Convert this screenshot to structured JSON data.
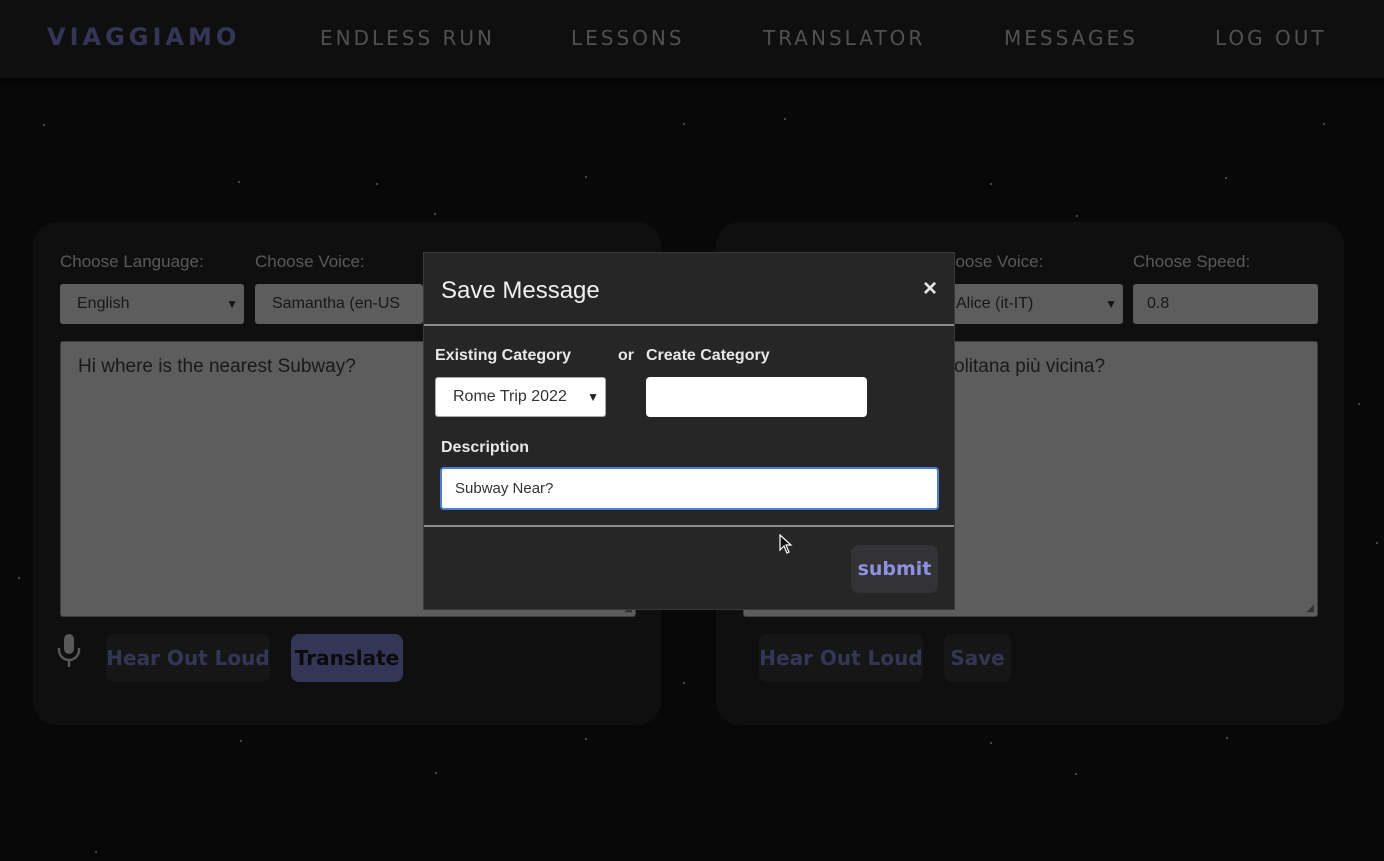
{
  "nav": {
    "brand": "VIAGGIAMO",
    "links": [
      "ENDLESS RUN",
      "LESSONS",
      "TRANSLATOR",
      "MESSAGES",
      "LOG OUT"
    ]
  },
  "left_panel": {
    "language_label": "Choose Language:",
    "language_value": "English",
    "voice_label": "Choose Voice:",
    "voice_value": "Samantha (en-US",
    "input_text": "Hi where is the nearest Subway?",
    "hear_button": "Hear Out Loud",
    "translate_button": "Translate"
  },
  "right_panel": {
    "voice_label": "hoose Voice:",
    "voice_value": "Alice (it-IT)",
    "speed_label": "Choose Speed:",
    "speed_value": "0.8",
    "output_text": "olitana più vicina?",
    "hear_button": "Hear Out Loud",
    "save_button": "Save"
  },
  "modal": {
    "title": "Save Message",
    "close": "×",
    "existing_category_label": "Existing Category",
    "or_label": "or",
    "create_category_label": "Create Category",
    "existing_category_value": "Rome Trip 2022",
    "create_category_value": "",
    "description_label": "Description",
    "description_value": "Subway Near?",
    "submit_button": "submit"
  },
  "colors": {
    "accent": "#5b5d96",
    "submit_text": "#8f91e0",
    "panel_bg": "#1b1b1c",
    "modal_bg": "#262627"
  }
}
